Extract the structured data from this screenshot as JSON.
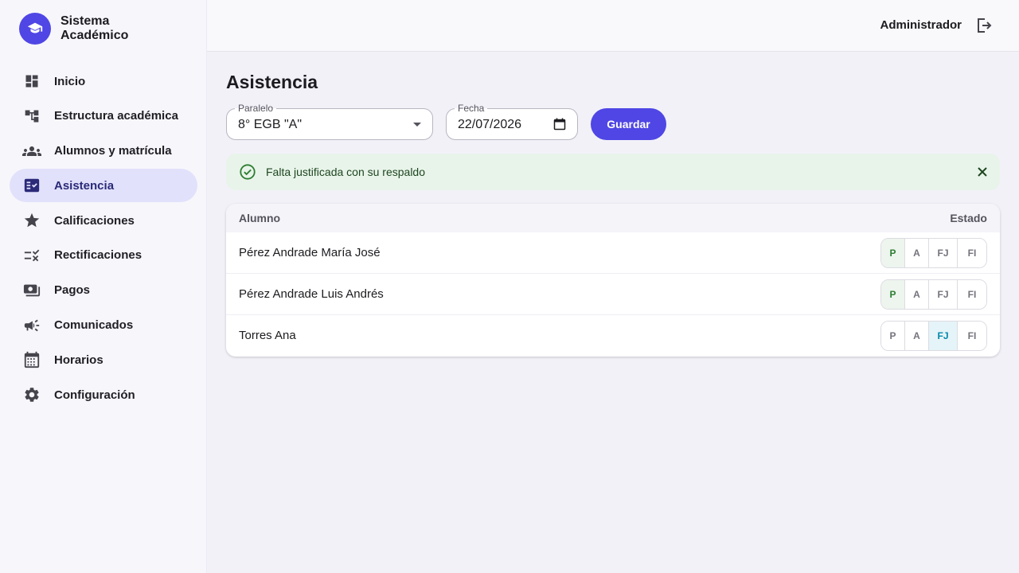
{
  "brand": {
    "title": "Sistema Académico",
    "icon": "graduation-cap-icon",
    "color": "#4f46e5"
  },
  "sidebar": {
    "items": [
      {
        "label": "Inicio",
        "icon": "dashboard-icon",
        "active": false
      },
      {
        "label": "Estructura académica",
        "icon": "account-tree-icon",
        "active": false
      },
      {
        "label": "Alumnos y matrícula",
        "icon": "people-icon",
        "active": false
      },
      {
        "label": "Asistencia",
        "icon": "fact-check-icon",
        "active": true
      },
      {
        "label": "Calificaciones",
        "icon": "star-icon",
        "active": false
      },
      {
        "label": "Rectificaciones",
        "icon": "rule-icon",
        "active": false
      },
      {
        "label": "Pagos",
        "icon": "payments-icon",
        "active": false
      },
      {
        "label": "Comunicados",
        "icon": "campaign-icon",
        "active": false
      },
      {
        "label": "Horarios",
        "icon": "calendar-icon",
        "active": false
      },
      {
        "label": "Configuración",
        "icon": "gear-icon",
        "active": false
      }
    ]
  },
  "topbar": {
    "user": "Administrador",
    "logout_icon": "logout-icon"
  },
  "page": {
    "title": "Asistencia"
  },
  "filters": {
    "paralelo_label": "Paralelo",
    "paralelo_value": "8° EGB \"A\"",
    "fecha_label": "Fecha",
    "fecha_value": "22/07/2026",
    "save_label": "Guardar"
  },
  "alert": {
    "message": "Falta justificada con su respaldo",
    "type": "success",
    "color": "#2e7d32"
  },
  "table": {
    "headers": {
      "student": "Alumno",
      "status": "Estado"
    },
    "options": [
      "P",
      "A",
      "FJ",
      "FI"
    ],
    "rows": [
      {
        "name": "Pérez Andrade María José",
        "status": "P"
      },
      {
        "name": "Pérez Andrade Luis Andrés",
        "status": "P"
      },
      {
        "name": "Torres Ana",
        "status": "FJ"
      }
    ]
  }
}
